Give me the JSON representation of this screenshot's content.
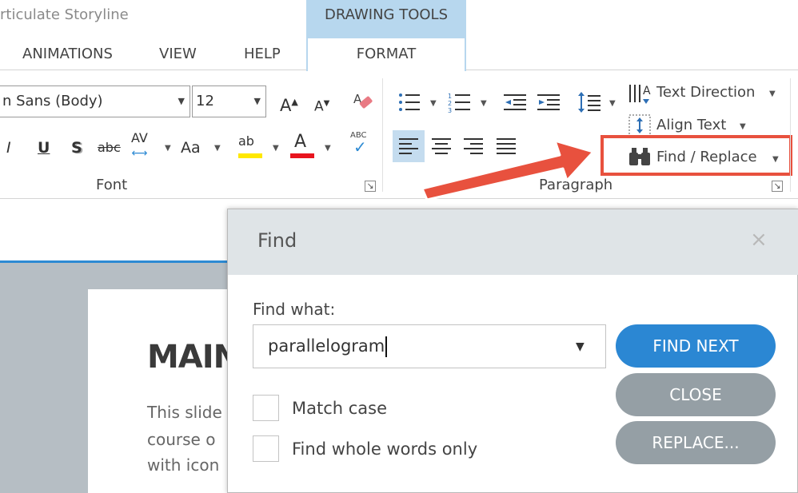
{
  "app": {
    "title": "rticulate Storyline"
  },
  "context_tab": {
    "header": "DRAWING TOOLS",
    "tab": "FORMAT"
  },
  "tabs": [
    "ANIMATIONS",
    "VIEW",
    "HELP"
  ],
  "font_group": {
    "label": "Font",
    "font_name": "n Sans (Body)",
    "font_size": "12",
    "underline_glyph": "U",
    "italic_glyph": "I",
    "shadow_glyph": "S",
    "strike_glyph": "abc",
    "spacing_glyph": "AV",
    "case_glyph": "Aa",
    "highlight_glyph": "ab",
    "color_glyph": "A",
    "spell_glyph": "ABC",
    "grow_glyph": "A",
    "shrink_glyph": "A",
    "highlight_color": "#ffe800",
    "font_color": "#e8141e"
  },
  "paragraph_group": {
    "label": "Paragraph",
    "text_direction": "Text Direction",
    "align_text": "Align Text",
    "find_replace": "Find / Replace"
  },
  "slide": {
    "title": "MAIN",
    "lines": [
      "This slide",
      "course o",
      "with icon"
    ]
  },
  "dialog": {
    "title": "Find",
    "close_glyph": "×",
    "find_label": "Find what:",
    "find_value": "parallelogram",
    "match_case": "Match case",
    "whole_words": "Find whole words only",
    "find_next": "FIND NEXT",
    "close": "CLOSE",
    "replace": "REPLACE..."
  },
  "colors": {
    "accent": "#2b87d3",
    "highlight": "#e8513e",
    "context_tab": "#b7d7ee"
  }
}
